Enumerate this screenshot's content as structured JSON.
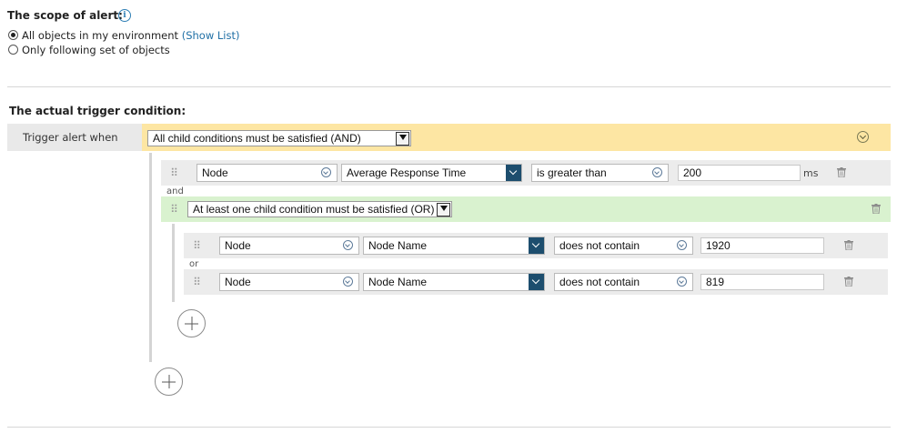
{
  "scope": {
    "title": "The scope of alert:",
    "option_all": "All objects in my environment",
    "show_list": "(Show List)",
    "option_set": "Only following set of objects",
    "selected": "all"
  },
  "trigger": {
    "title": "The actual trigger condition:",
    "label": "Trigger alert when",
    "group_and": "All child conditions must be satisfied (AND)",
    "conditions": [
      {
        "object": "Node",
        "field": "Average Response Time",
        "operator": "is greater than",
        "value": "200",
        "unit": "ms"
      }
    ],
    "and_label": "and",
    "group_or": "At least one child condition must be satisfied (OR)",
    "or_conditions": [
      {
        "object": "Node",
        "field": "Node Name",
        "operator": "does not contain",
        "value": "1920"
      },
      {
        "object": "Node",
        "field": "Node Name",
        "operator": "does not contain",
        "value": "819"
      }
    ],
    "or_label": "or"
  },
  "colors": {
    "and_bar": "#fde6a3",
    "or_bar": "#d9f2cf",
    "label_bg": "#e9e9e9",
    "link": "#1f6fa5",
    "accent_dark": "#1d4e6e"
  }
}
